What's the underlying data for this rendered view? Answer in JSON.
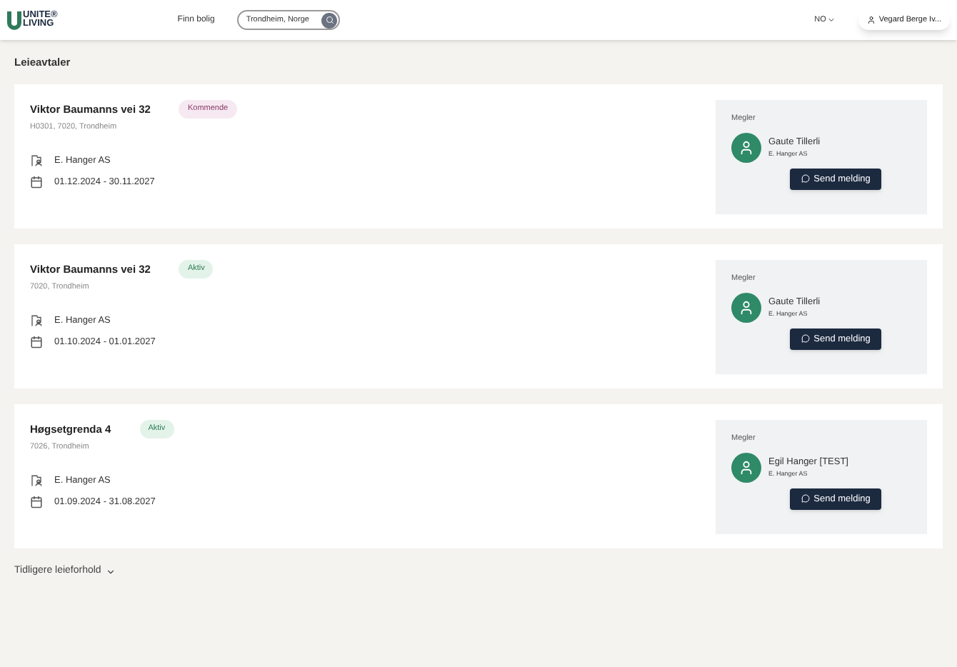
{
  "header": {
    "logo": {
      "line1": "UNITE®",
      "line2": "LIVING"
    },
    "nav_link": "Finn bolig",
    "search": {
      "value": "Trondheim, Norge"
    },
    "language": "NO",
    "user": "Vegard Berge Iv..."
  },
  "page_title": "Leieavtaler",
  "leases": [
    {
      "address": "Viktor Baumanns vei 32",
      "status": {
        "label": "Kommende",
        "kind": "upcoming"
      },
      "location": "H0301, 7020, Trondheim",
      "landlord": "E. Hanger AS",
      "period": "01.12.2024 - 30.11.2027",
      "broker": {
        "heading": "Megler",
        "name": "Gaute Tillerli",
        "company": "E. Hanger AS",
        "button": "Send melding"
      }
    },
    {
      "address": "Viktor Baumanns vei 32",
      "status": {
        "label": "Aktiv",
        "kind": "active"
      },
      "location": "7020, Trondheim",
      "landlord": "E. Hanger AS",
      "period": "01.10.2024 - 01.01.2027",
      "broker": {
        "heading": "Megler",
        "name": "Gaute Tillerli",
        "company": "E. Hanger AS",
        "button": "Send melding"
      }
    },
    {
      "address": "Høgsetgrenda 4",
      "status": {
        "label": "Aktiv",
        "kind": "active"
      },
      "location": "7026, Trondheim",
      "landlord": "E. Hanger AS",
      "period": "01.09.2024 - 31.08.2027",
      "broker": {
        "heading": "Megler",
        "name": "Egil Hanger [TEST]",
        "company": "E. Hanger AS",
        "button": "Send melding"
      }
    }
  ],
  "previous": {
    "label": "Tidligere leieforhold",
    "expanded": false
  }
}
